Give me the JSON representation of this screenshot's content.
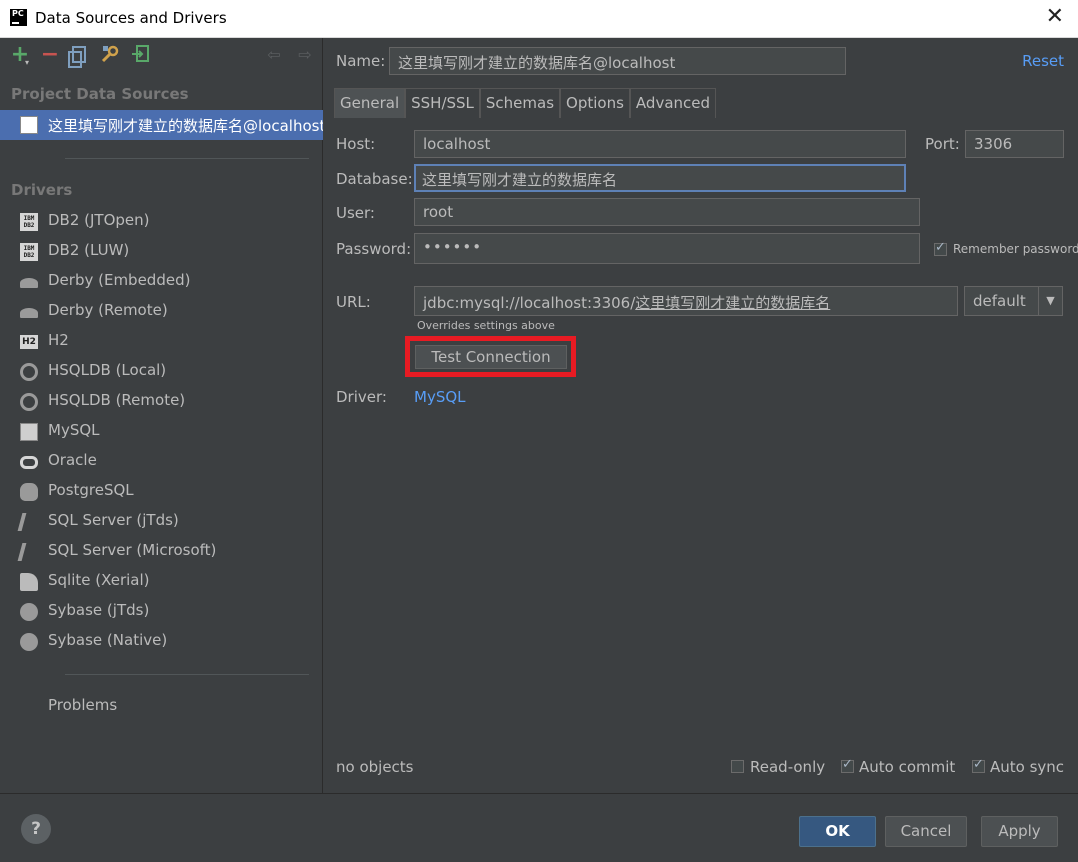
{
  "window": {
    "title": "Data Sources and Drivers",
    "app_icon": "pc-icon",
    "close_label": "✕"
  },
  "left_panel": {
    "project_heading": "Project Data Sources",
    "selected_data_source": "这里填写刚才建立的数据库名@localhost",
    "drivers_heading": "Drivers",
    "drivers": [
      {
        "label": "DB2 (JTOpen)",
        "icon": "db2-icon"
      },
      {
        "label": "DB2 (LUW)",
        "icon": "db2-icon"
      },
      {
        "label": "Derby (Embedded)",
        "icon": "derby-icon"
      },
      {
        "label": "Derby (Remote)",
        "icon": "derby-icon"
      },
      {
        "label": "H2",
        "icon": "h2-icon"
      },
      {
        "label": "HSQLDB (Local)",
        "icon": "hsqldb-icon"
      },
      {
        "label": "HSQLDB (Remote)",
        "icon": "hsqldb-icon"
      },
      {
        "label": "MySQL",
        "icon": "mysql-icon"
      },
      {
        "label": "Oracle",
        "icon": "oracle-icon"
      },
      {
        "label": "PostgreSQL",
        "icon": "postgresql-icon"
      },
      {
        "label": "SQL Server (jTds)",
        "icon": "sqlserver-icon"
      },
      {
        "label": "SQL Server (Microsoft)",
        "icon": "sqlserver-icon"
      },
      {
        "label": "Sqlite (Xerial)",
        "icon": "sqlite-icon"
      },
      {
        "label": "Sybase (jTds)",
        "icon": "sybase-icon"
      },
      {
        "label": "Sybase (Native)",
        "icon": "sybase-icon"
      }
    ],
    "problems_label": "Problems"
  },
  "right_panel": {
    "name_label": "Name:",
    "name_value": "这里填写刚才建立的数据库名@localhost",
    "reset_label": "Reset",
    "tabs": [
      "General",
      "SSH/SSL",
      "Schemas",
      "Options",
      "Advanced"
    ],
    "active_tab": "General",
    "host_label": "Host:",
    "host_value": "localhost",
    "port_label": "Port:",
    "port_value": "3306",
    "database_label": "Database:",
    "database_value": "这里填写刚才建立的数据库名",
    "user_label": "User:",
    "user_value": "root",
    "password_label": "Password:",
    "password_value": "••••••",
    "remember_password_label": "Remember password",
    "remember_password_checked": true,
    "url_label": "URL:",
    "url_prefix": "jdbc:mysql://localhost:3306/",
    "url_db": "这里填写刚才建立的数据库名",
    "url_mode": "default",
    "url_mode_arrow": "▼",
    "overrides_note": "Overrides settings above",
    "test_connection_label": "Test Connection",
    "highlight_color": "#e81b23",
    "driver_label": "Driver:",
    "driver_value": "MySQL",
    "status_text": "no objects",
    "read_only_label": "Read-only",
    "read_only_checked": false,
    "auto_commit_label": "Auto commit",
    "auto_commit_checked": true,
    "auto_sync_label": "Auto sync",
    "auto_sync_checked": true
  },
  "footer": {
    "help_label": "?",
    "ok_label": "OK",
    "cancel_label": "Cancel",
    "apply_label": "Apply"
  },
  "colors": {
    "background": "#3c3f41",
    "selection": "#4b6eaf",
    "link": "#589df6",
    "ok_button": "#365880"
  }
}
